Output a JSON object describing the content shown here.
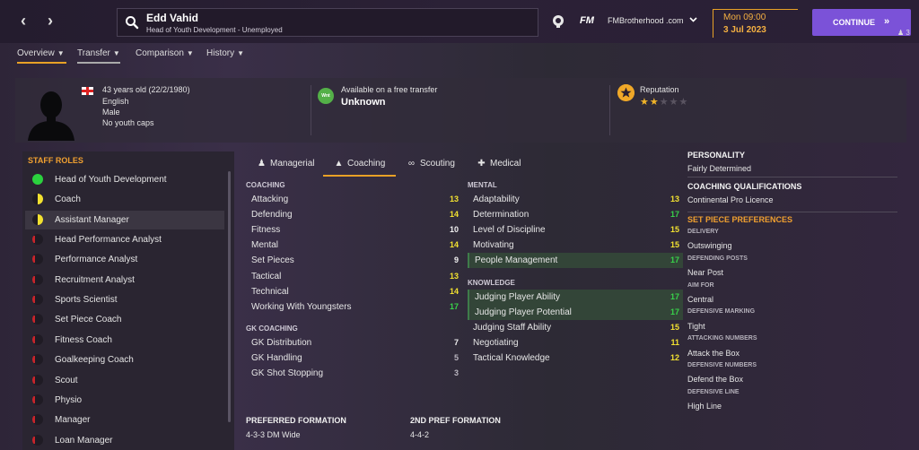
{
  "header": {
    "name": "Edd Vahid",
    "subtitle": "Head of Youth Development - Unemployed",
    "fm_label": "FM",
    "site": "FMBrotherhood .com",
    "day": "Mon 09:00",
    "date": "3 Jul 2023",
    "continue_label": "CONTINUE",
    "continue_arrows": "»",
    "user_count": "3"
  },
  "tabs": [
    {
      "label": "Overview"
    },
    {
      "label": "Transfer"
    },
    {
      "label": "Comparison"
    },
    {
      "label": "History"
    }
  ],
  "profile": {
    "age": "43 years old (22/2/1980)",
    "nationality": "English",
    "gender": "Male",
    "caps": "No youth caps",
    "transfer_badge": "Wnt",
    "transfer_label": "Available on a free transfer",
    "transfer_value": "Unknown",
    "reputation_label": "Reputation",
    "reputation_stars": 1.5,
    "reputation_max": 5
  },
  "roles": {
    "title": "STAFF ROLES",
    "items": [
      {
        "label": "Head of Youth Development",
        "suitability": "full"
      },
      {
        "label": "Coach",
        "suitability": "half"
      },
      {
        "label": "Assistant Manager",
        "suitability": "half"
      },
      {
        "label": "Head Performance Analyst",
        "suitability": "none"
      },
      {
        "label": "Performance Analyst",
        "suitability": "none"
      },
      {
        "label": "Recruitment Analyst",
        "suitability": "none"
      },
      {
        "label": "Sports Scientist",
        "suitability": "none"
      },
      {
        "label": "Set Piece Coach",
        "suitability": "none"
      },
      {
        "label": "Fitness Coach",
        "suitability": "none"
      },
      {
        "label": "Goalkeeping Coach",
        "suitability": "none"
      },
      {
        "label": "Scout",
        "suitability": "none"
      },
      {
        "label": "Physio",
        "suitability": "none"
      },
      {
        "label": "Manager",
        "suitability": "none"
      },
      {
        "label": "Loan Manager",
        "suitability": "none"
      }
    ]
  },
  "center_tabs": [
    {
      "label": "Managerial",
      "icon": "manager-icon"
    },
    {
      "label": "Coaching",
      "icon": "coach-icon"
    },
    {
      "label": "Scouting",
      "icon": "binoculars-icon"
    },
    {
      "label": "Medical",
      "icon": "medical-icon"
    }
  ],
  "attributes": {
    "coaching_title": "COACHING",
    "coaching": [
      {
        "name": "Attacking",
        "value": "13"
      },
      {
        "name": "Defending",
        "value": "14"
      },
      {
        "name": "Fitness",
        "value": "10"
      },
      {
        "name": "Mental",
        "value": "14"
      },
      {
        "name": "Set Pieces",
        "value": "9"
      },
      {
        "name": "Tactical",
        "value": "13"
      },
      {
        "name": "Technical",
        "value": "14"
      },
      {
        "name": "Working With Youngsters",
        "value": "17"
      }
    ],
    "gk_title": "GK COACHING",
    "gk": [
      {
        "name": "GK Distribution",
        "value": "7"
      },
      {
        "name": "GK Handling",
        "value": "5"
      },
      {
        "name": "GK Shot Stopping",
        "value": "3"
      }
    ],
    "mental_title": "MENTAL",
    "mental": [
      {
        "name": "Adaptability",
        "value": "13"
      },
      {
        "name": "Determination",
        "value": "17"
      },
      {
        "name": "Level of Discipline",
        "value": "15"
      },
      {
        "name": "Motivating",
        "value": "15"
      },
      {
        "name": "People Management",
        "value": "17"
      }
    ],
    "knowledge_title": "KNOWLEDGE",
    "knowledge": [
      {
        "name": "Judging Player Ability",
        "value": "17"
      },
      {
        "name": "Judging Player Potential",
        "value": "17"
      },
      {
        "name": "Judging Staff Ability",
        "value": "15"
      },
      {
        "name": "Negotiating",
        "value": "11"
      },
      {
        "name": "Tactical Knowledge",
        "value": "12"
      }
    ]
  },
  "formations": {
    "pref_title": "PREFERRED FORMATION",
    "pref_value": "4-3-3 DM Wide",
    "second_title": "2ND PREF FORMATION",
    "second_value": "4-4-2"
  },
  "side": {
    "personality_title": "PERSONALITY",
    "personality": "Fairly Determined",
    "quals_title": "COACHING QUALIFICATIONS",
    "quals": "Continental Pro Licence",
    "setpiece_title": "SET PIECE PREFERENCES",
    "delivery_title": "DELIVERY",
    "delivery": "Outswinging",
    "def_posts_title": "DEFENDING POSTS",
    "def_posts": "Near Post",
    "aim_title": "AIM FOR",
    "aim": "Central",
    "def_marking_title": "DEFENSIVE MARKING",
    "def_marking": "Tight",
    "att_numbers_title": "ATTACKING NUMBERS",
    "att_numbers": "Attack the Box",
    "def_numbers_title": "DEFENSIVE NUMBERS",
    "def_numbers": "Defend the Box",
    "def_line_title": "DEFENSIVE LINE",
    "def_line": "High Line"
  }
}
